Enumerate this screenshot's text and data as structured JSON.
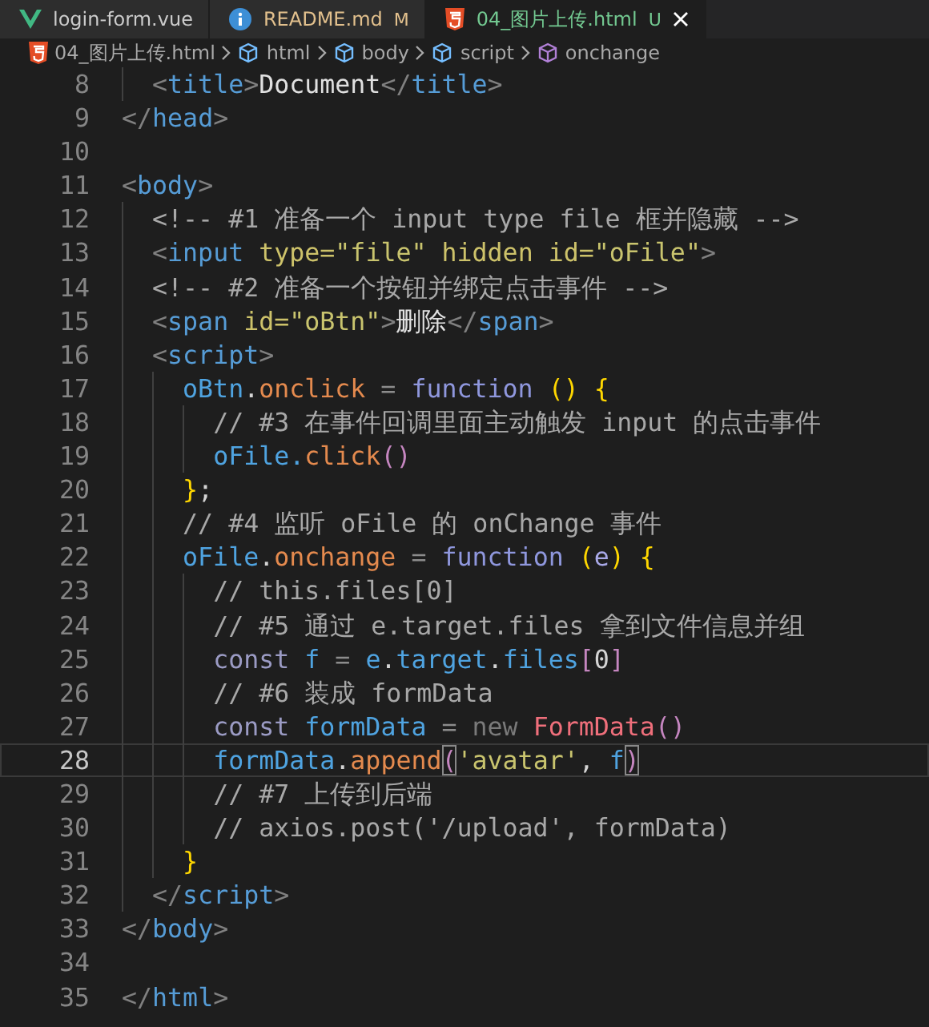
{
  "tabs": [
    {
      "label": "login-form.vue",
      "kind": "vue",
      "color": "#cccccc",
      "selected": false
    },
    {
      "label": "README.md",
      "kind": "info",
      "color": "#e2c08d",
      "badge": "M",
      "selected": false
    },
    {
      "label": "04_图片上传.html",
      "kind": "html",
      "color": "#73c991",
      "badge": "U",
      "selected": true
    }
  ],
  "breadcrumb": [
    {
      "label": "04_图片上传.html",
      "kind": "file"
    },
    {
      "label": "html",
      "kind": "element"
    },
    {
      "label": "body",
      "kind": "element"
    },
    {
      "label": "script",
      "kind": "element"
    },
    {
      "label": "onchange",
      "kind": "method"
    }
  ],
  "lines": [
    {
      "number": "8",
      "current": false,
      "tokens": [
        {
          "kind": "punct",
          "text": "  <"
        },
        {
          "kind": "tag",
          "text": "title"
        },
        {
          "kind": "punct",
          "text": ">"
        },
        {
          "kind": "text",
          "text": "Document"
        },
        {
          "kind": "punct",
          "text": "</"
        },
        {
          "kind": "tag",
          "text": "title"
        },
        {
          "kind": "punct",
          "text": ">"
        }
      ]
    },
    {
      "number": "9",
      "current": false,
      "tokens": [
        {
          "kind": "punct",
          "text": "</"
        },
        {
          "kind": "tag",
          "text": "head"
        },
        {
          "kind": "punct",
          "text": ">"
        }
      ]
    },
    {
      "number": "10",
      "current": false
    },
    {
      "number": "11",
      "current": false,
      "tokens": [
        {
          "kind": "punct",
          "text": "<"
        },
        {
          "kind": "tag",
          "text": "body"
        },
        {
          "kind": "punct",
          "text": ">"
        }
      ]
    },
    {
      "number": "12",
      "current": false,
      "tokens": [
        {
          "kind": "comment",
          "text": "  <!-- #1 准备一个 input type file 框并隐藏 -->"
        }
      ]
    },
    {
      "number": "13",
      "current": false,
      "tokens": [
        {
          "kind": "punct",
          "text": "  <"
        },
        {
          "kind": "tag",
          "text": "input"
        },
        {
          "kind": "attr",
          "text": " type="
        },
        {
          "kind": "string",
          "text": "\"file\""
        },
        {
          "kind": "attr",
          "text": " hidden id="
        },
        {
          "kind": "string",
          "text": "\"oFile\""
        },
        {
          "kind": "punct",
          "text": ">"
        }
      ]
    },
    {
      "number": "14",
      "current": false,
      "tokens": [
        {
          "kind": "comment",
          "text": "  <!-- #2 准备一个按钮并绑定点击事件 -->"
        }
      ]
    },
    {
      "number": "15",
      "current": false,
      "tokens": [
        {
          "kind": "punct",
          "text": "  <"
        },
        {
          "kind": "tag",
          "text": "span"
        },
        {
          "kind": "attr",
          "text": " id="
        },
        {
          "kind": "string",
          "text": "\"oBtn\""
        },
        {
          "kind": "punct",
          "text": ">"
        },
        {
          "kind": "text",
          "text": "删除"
        },
        {
          "kind": "punct",
          "text": "</"
        },
        {
          "kind": "tag",
          "text": "span"
        },
        {
          "kind": "punct",
          "text": ">"
        }
      ]
    },
    {
      "number": "16",
      "current": false,
      "tokens": [
        {
          "kind": "punct",
          "text": "  <"
        },
        {
          "kind": "tag",
          "text": "script"
        },
        {
          "kind": "punct",
          "text": ">"
        }
      ]
    },
    {
      "number": "17",
      "current": false,
      "tokens": [
        {
          "kind": "var",
          "text": "    oBtn"
        },
        {
          "kind": "plain",
          "text": "."
        },
        {
          "kind": "prop",
          "text": "onclick"
        },
        {
          "kind": "op",
          "text": " = "
        },
        {
          "kind": "keyword",
          "text": "function"
        },
        {
          "kind": "paren",
          "text": " () {"
        }
      ]
    },
    {
      "number": "18",
      "current": false,
      "tokens": [
        {
          "kind": "comment",
          "text": "      // #3 在事件回调里面主动触发 input 的点击事件"
        }
      ]
    },
    {
      "number": "19",
      "current": false,
      "tokens": [
        {
          "kind": "var",
          "text": "      oFile."
        },
        {
          "kind": "prop",
          "text": "click"
        },
        {
          "kind": "paren2",
          "text": "()"
        }
      ]
    },
    {
      "number": "20",
      "current": false,
      "tokens": [
        {
          "kind": "paren",
          "text": "    }"
        },
        {
          "kind": "plain",
          "text": ";"
        }
      ]
    },
    {
      "number": "21",
      "current": false,
      "tokens": [
        {
          "kind": "comment",
          "text": "    // #4 监听 oFile 的 onChange 事件"
        }
      ]
    },
    {
      "number": "22",
      "current": false,
      "tokens": [
        {
          "kind": "var",
          "text": "    oFile"
        },
        {
          "kind": "plain",
          "text": "."
        },
        {
          "kind": "prop",
          "text": "onchange"
        },
        {
          "kind": "op",
          "text": " = "
        },
        {
          "kind": "keyword",
          "text": "function"
        },
        {
          "kind": "paren",
          "text": " ("
        },
        {
          "kind": "param",
          "text": "e"
        },
        {
          "kind": "paren",
          "text": ") {"
        }
      ]
    },
    {
      "number": "23",
      "current": false,
      "tokens": [
        {
          "kind": "comment",
          "text": "      // this.files[0]"
        }
      ]
    },
    {
      "number": "24",
      "current": false,
      "tokens": [
        {
          "kind": "comment",
          "text": "      // #5 通过 e.target.files 拿到文件信息并组"
        }
      ]
    },
    {
      "number": "25",
      "current": false,
      "tokens": [
        {
          "kind": "storage",
          "text": "      const"
        },
        {
          "kind": "var",
          "text": " f"
        },
        {
          "kind": "op",
          "text": " = "
        },
        {
          "kind": "var",
          "text": "e"
        },
        {
          "kind": "plain",
          "text": "."
        },
        {
          "kind": "var",
          "text": "target"
        },
        {
          "kind": "plain",
          "text": "."
        },
        {
          "kind": "var",
          "text": "files"
        },
        {
          "kind": "paren2",
          "text": "["
        },
        {
          "kind": "plain",
          "text": "0"
        },
        {
          "kind": "paren2",
          "text": "]"
        }
      ]
    },
    {
      "number": "26",
      "current": false,
      "tokens": [
        {
          "kind": "comment",
          "text": "      // #6 装成 formData"
        }
      ]
    },
    {
      "number": "27",
      "current": false,
      "tokens": [
        {
          "kind": "storage",
          "text": "      const"
        },
        {
          "kind": "var",
          "text": " formData"
        },
        {
          "kind": "op",
          "text": " = "
        },
        {
          "kind": "new",
          "text": "new"
        },
        {
          "kind": "class",
          "text": " FormData"
        },
        {
          "kind": "paren2",
          "text": "()"
        }
      ]
    },
    {
      "number": "28",
      "current": true,
      "tokens": [
        {
          "kind": "var",
          "text": "      formData"
        },
        {
          "kind": "plain",
          "text": "."
        },
        {
          "kind": "prop",
          "text": "append"
        },
        {
          "kind": "match",
          "text": "("
        },
        {
          "kind": "string",
          "text": "'avatar'"
        },
        {
          "kind": "plain",
          "text": ", "
        },
        {
          "kind": "var",
          "text": "f"
        },
        {
          "kind": "match",
          "text": ")"
        }
      ]
    },
    {
      "number": "29",
      "current": false,
      "tokens": [
        {
          "kind": "comment",
          "text": "      // #7 上传到后端"
        }
      ]
    },
    {
      "number": "30",
      "current": false,
      "tokens": [
        {
          "kind": "comment",
          "text": "      // axios.post('/upload', formData)"
        }
      ]
    },
    {
      "number": "31",
      "current": false,
      "tokens": [
        {
          "kind": "paren",
          "text": "    }"
        }
      ]
    },
    {
      "number": "32",
      "current": false,
      "tokens": [
        {
          "kind": "punct",
          "text": "  </"
        },
        {
          "kind": "tag",
          "text": "script"
        },
        {
          "kind": "punct",
          "text": ">"
        }
      ]
    },
    {
      "number": "33",
      "current": false,
      "tokens": [
        {
          "kind": "punct",
          "text": "</"
        },
        {
          "kind": "tag",
          "text": "body"
        },
        {
          "kind": "punct",
          "text": ">"
        }
      ]
    },
    {
      "number": "34",
      "current": false
    },
    {
      "number": "35",
      "current": false,
      "tokens": [
        {
          "kind": "punct",
          "text": "</"
        },
        {
          "kind": "tag",
          "text": "html"
        },
        {
          "kind": "punct",
          "text": ">"
        }
      ]
    }
  ]
}
